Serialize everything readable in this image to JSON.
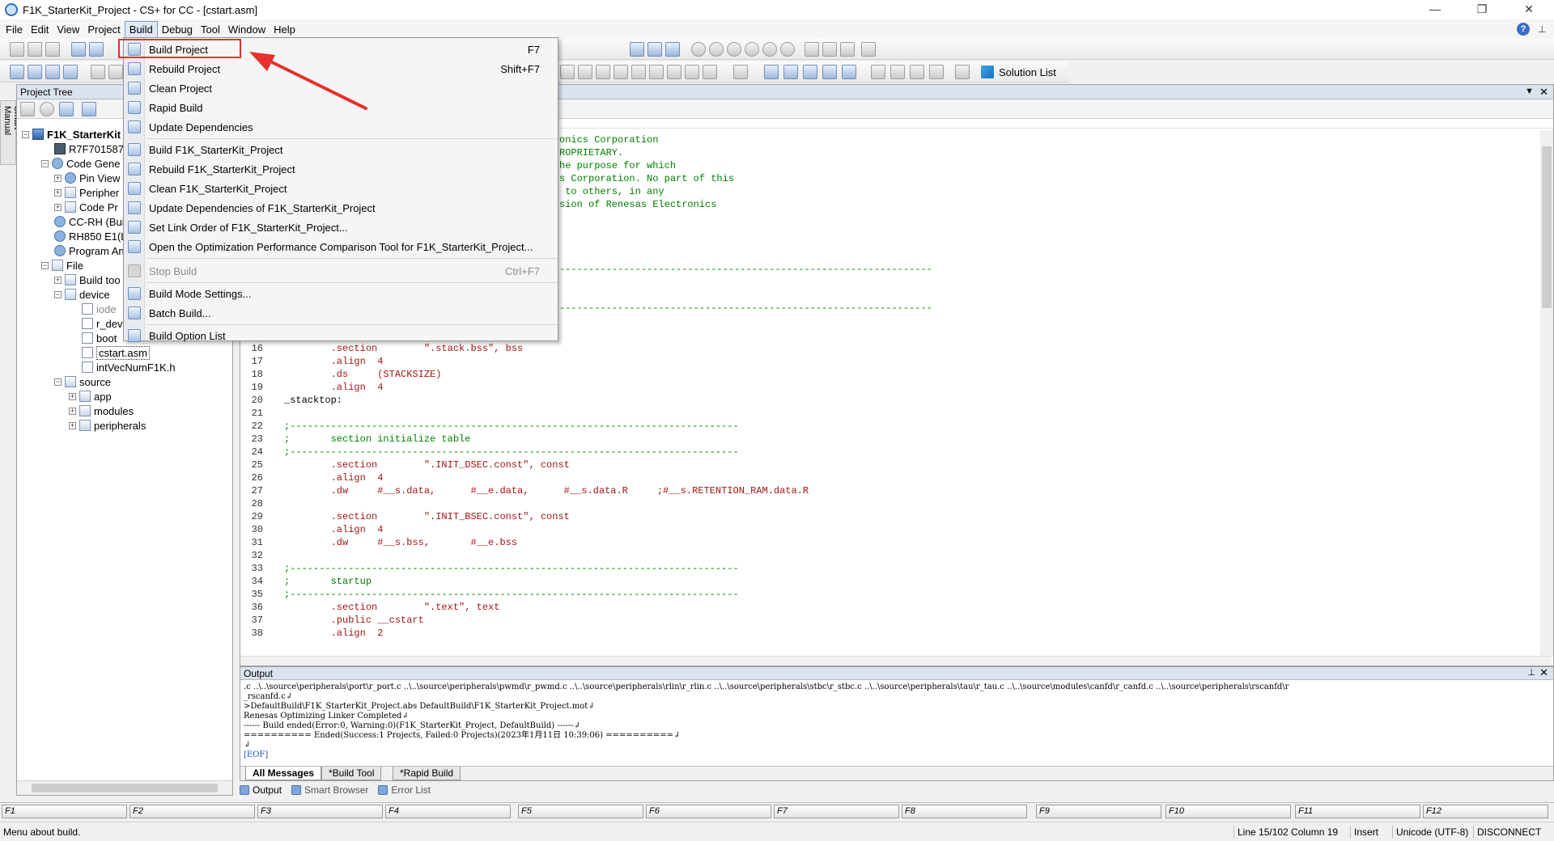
{
  "window": {
    "title": "F1K_StarterKit_Project - CS+ for CC - [cstart.asm]",
    "minimize": "—",
    "restore": "❐",
    "close": "✕"
  },
  "menubar": {
    "items": [
      "File",
      "Edit",
      "View",
      "Project",
      "Build",
      "Debug",
      "Tool",
      "Window",
      "Help"
    ],
    "active": "Build"
  },
  "toolbar": {
    "solution_list_label": "Solution List"
  },
  "side_tab": {
    "label": "Smart Manual"
  },
  "project_tree": {
    "title": "Project Tree",
    "items": [
      {
        "label": "F1K_StarterKit",
        "bold": true
      },
      {
        "label": "R7F701587"
      },
      {
        "label": "Code Gene"
      },
      {
        "label": "Pin View"
      },
      {
        "label": "Peripher"
      },
      {
        "label": "Code Pr"
      },
      {
        "label": "CC-RH (Buil"
      },
      {
        "label": "RH850 E1(L"
      },
      {
        "label": "Program An"
      },
      {
        "label": "File"
      },
      {
        "label": "Build too"
      },
      {
        "label": "device"
      },
      {
        "label": "iode"
      },
      {
        "label": "r_dev"
      },
      {
        "label": "boot"
      },
      {
        "label": "cstart.asm"
      },
      {
        "label": "intVecNumF1K.h"
      },
      {
        "label": "source"
      },
      {
        "label": "app"
      },
      {
        "label": "modules"
      },
      {
        "label": "peripherals"
      }
    ]
  },
  "build_menu": {
    "items": [
      {
        "label": "Build Project",
        "shortcut": "F7"
      },
      {
        "label": "Rebuild Project",
        "shortcut": "Shift+F7"
      },
      {
        "label": "Clean Project",
        "shortcut": ""
      },
      {
        "label": "Rapid Build",
        "shortcut": ""
      },
      {
        "label": "Update Dependencies",
        "shortcut": ""
      },
      {
        "label": "Build F1K_StarterKit_Project",
        "shortcut": ""
      },
      {
        "label": "Rebuild F1K_StarterKit_Project",
        "shortcut": ""
      },
      {
        "label": "Clean F1K_StarterKit_Project",
        "shortcut": ""
      },
      {
        "label": "Update Dependencies of F1K_StarterKit_Project",
        "shortcut": ""
      },
      {
        "label": "Set Link Order of F1K_StarterKit_Project...",
        "shortcut": ""
      },
      {
        "label": "Open the Optimization Performance Comparison Tool for F1K_StarterKit_Project...",
        "shortcut": ""
      },
      {
        "label": "Stop Build",
        "shortcut": "Ctrl+F7",
        "disabled": true
      },
      {
        "label": "Build Mode Settings...",
        "shortcut": ""
      },
      {
        "label": "Batch Build...",
        "shortcut": ""
      },
      {
        "label": "Build Option List",
        "shortcut": ""
      }
    ]
  },
  "editor": {
    "partial_lines": [
      "onics Corporation",
      "ROPRIETARY.",
      "he purpose for which",
      "s Corporation. No part of this",
      " to others, in any",
      "sion of Renesas Electronics"
    ],
    "lines": [
      {
        "n": "16",
        "t": "        .section        \".stack.bss\", bss"
      },
      {
        "n": "17",
        "t": "        .align  4"
      },
      {
        "n": "18",
        "t": "        .ds     (STACKSIZE)"
      },
      {
        "n": "19",
        "t": "        .align  4"
      },
      {
        "n": "20",
        "t": "_stacktop:"
      },
      {
        "n": "21",
        "t": ""
      },
      {
        "n": "22",
        "t": ";-----------------------------------------------------------------------------"
      },
      {
        "n": "23",
        "t": ";       section initialize table"
      },
      {
        "n": "24",
        "t": ";-----------------------------------------------------------------------------"
      },
      {
        "n": "25",
        "t": "        .section        \".INIT_DSEC.const\", const"
      },
      {
        "n": "26",
        "t": "        .align  4"
      },
      {
        "n": "27",
        "t": "        .dw     #__s.data,      #__e.data,      #__s.data.R     ;#__s.RETENTION_RAM.data.R"
      },
      {
        "n": "28",
        "t": ""
      },
      {
        "n": "29",
        "t": "        .section        \".INIT_BSEC.const\", const"
      },
      {
        "n": "30",
        "t": "        .align  4"
      },
      {
        "n": "31",
        "t": "        .dw     #__s.bss,       #__e.bss"
      },
      {
        "n": "32",
        "t": ""
      },
      {
        "n": "33",
        "t": ";-----------------------------------------------------------------------------"
      },
      {
        "n": "34",
        "t": ";       startup"
      },
      {
        "n": "35",
        "t": ";-----------------------------------------------------------------------------"
      },
      {
        "n": "36",
        "t": "        .section        \".text\", text"
      },
      {
        "n": "37",
        "t": "        .public __cstart"
      },
      {
        "n": "38",
        "t": "        .align  2"
      }
    ]
  },
  "output": {
    "title": "Output",
    "lines": [
      ".c ..\\..\\source\\peripherals\\port\\r_port.c ..\\..\\source\\peripherals\\pwmd\\r_pwmd.c ..\\..\\source\\peripherals\\rlin\\r_rlin.c ..\\..\\source\\peripherals\\stbc\\r_stbc.c ..\\..\\source\\peripherals\\tau\\r_tau.c ..\\..\\source\\modules\\canfd\\r_canfd.c ..\\..\\source\\peripherals\\rscanfd\\r",
      "_rscanfd.c↲",
      ">DefaultBuild\\F1K_StarterKit_Project.abs DefaultBuild\\F1K_StarterKit_Project.mot↲",
      "Renesas Optimizing Linker Completed↲",
      "------ Build ended(Error:0, Warning:0)(F1K_StarterKit_Project, DefaultBuild) ------↲",
      "========== Ended(Success:1 Projects, Failed:0 Projects)(2023年1月11日 10:39:06) ==========↲",
      "↲",
      "[EOF]"
    ],
    "tabs": [
      "All Messages",
      "*Build Tool",
      "*Rapid Build"
    ]
  },
  "panel_tabs": [
    "Output",
    "Smart Browser",
    "Error List"
  ],
  "fkeys": [
    "F1",
    "F2",
    "F3",
    "F4",
    "F5",
    "F6",
    "F7",
    "F8",
    "F9",
    "F10",
    "F11",
    "F12"
  ],
  "status": {
    "message": "Menu about build.",
    "position": "Line 15/102  Column 19",
    "mode": "Insert",
    "encoding": "Unicode (UTF-8)",
    "connection": "DISCONNECT"
  },
  "colors": {
    "highlight": "#e8302c",
    "comment": "#008000",
    "directive": "#a31515"
  }
}
